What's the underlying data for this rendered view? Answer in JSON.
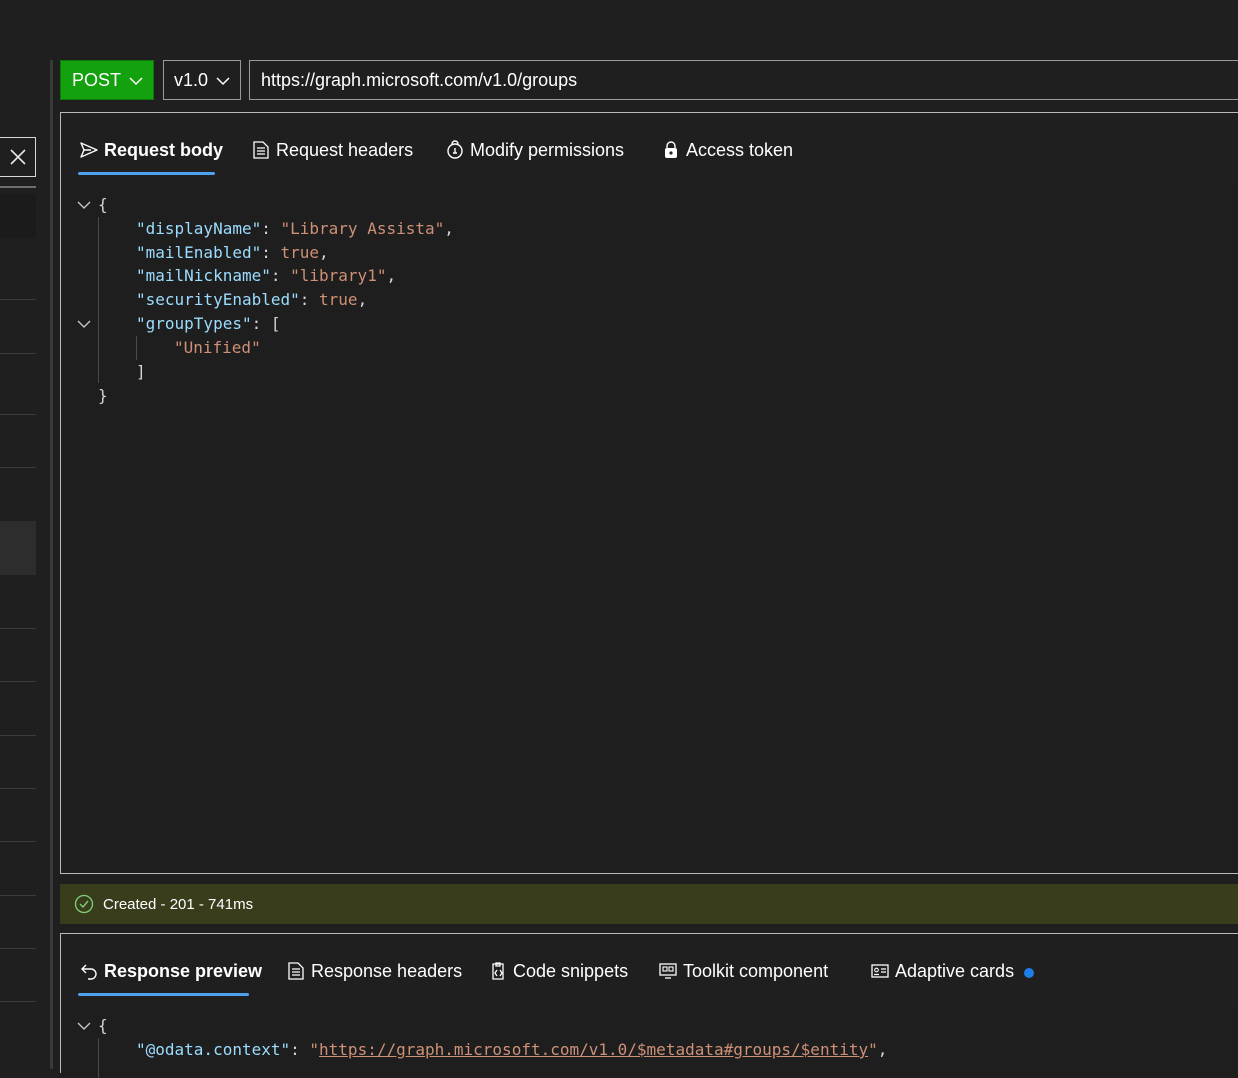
{
  "request": {
    "method": "POST",
    "version": "v1.0",
    "url": "https://graph.microsoft.com/v1.0/groups"
  },
  "request_tabs": [
    {
      "label": "Request body",
      "icon": "send-icon"
    },
    {
      "label": "Request headers",
      "icon": "document-icon"
    },
    {
      "label": "Modify permissions",
      "icon": "permission-icon"
    },
    {
      "label": "Access token",
      "icon": "lock-icon"
    }
  ],
  "request_body": {
    "open_brace": "{",
    "lines": [
      {
        "key": "\"displayName\"",
        "value": "\"Library Assista\"",
        "trail": ","
      },
      {
        "key": "\"mailEnabled\"",
        "value": "true",
        "trail": ","
      },
      {
        "key": "\"mailNickname\"",
        "value": "\"library1\"",
        "trail": ","
      },
      {
        "key": "\"securityEnabled\"",
        "value": "true",
        "trail": ","
      },
      {
        "key": "\"groupTypes\"",
        "value": "[",
        "trail": ""
      }
    ],
    "array_item": "\"Unified\"",
    "array_close": "]",
    "close_brace": "}"
  },
  "status": {
    "text": "Created - 201 - 741ms",
    "color": "#393d1b"
  },
  "response_tabs": [
    {
      "label": "Response preview",
      "icon": "undo-icon"
    },
    {
      "label": "Response headers",
      "icon": "document-icon"
    },
    {
      "label": "Code snippets",
      "icon": "code-icon"
    },
    {
      "label": "Toolkit component",
      "icon": "toolkit-icon"
    },
    {
      "label": "Adaptive cards",
      "icon": "card-icon"
    }
  ],
  "response_body": {
    "open_brace": "{",
    "context_key": "\"@odata.context\"",
    "context_value": "https://graph.microsoft.com/v1.0/$metadata#groups/$entity",
    "context_quote": "\"",
    "context_trail": ","
  },
  "colors": {
    "method_bg": "#13a10e",
    "accent": "#4ea1ef",
    "json_key": "#9cdcfe",
    "json_string": "#ce9178",
    "notification_dot": "#1c7ee6"
  }
}
